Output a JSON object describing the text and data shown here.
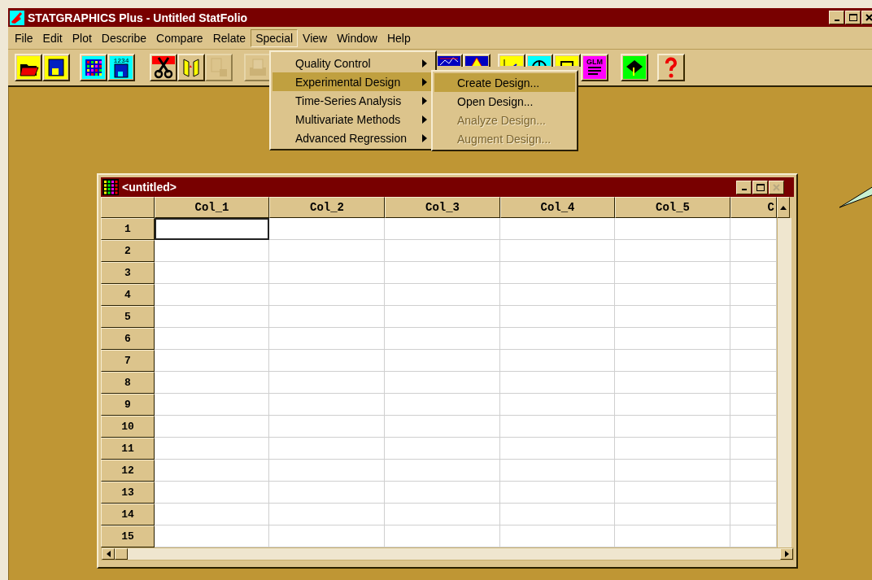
{
  "window": {
    "title": "STATGRAPHICS Plus - Untitled StatFolio",
    "controls": [
      {
        "kind": "minimize",
        "disabled": false
      },
      {
        "kind": "maximize",
        "disabled": false
      },
      {
        "kind": "close",
        "disabled": false
      }
    ]
  },
  "menu_bar": [
    {
      "label": "File",
      "selected": false
    },
    {
      "label": "Edit",
      "selected": false
    },
    {
      "label": "Plot",
      "selected": false
    },
    {
      "label": "Describe",
      "selected": false
    },
    {
      "label": "Compare",
      "selected": false
    },
    {
      "label": "Relate",
      "selected": false
    },
    {
      "label": "Special",
      "selected": true
    },
    {
      "label": "View",
      "selected": false
    },
    {
      "label": "Window",
      "selected": false
    },
    {
      "label": "Help",
      "selected": false
    }
  ],
  "toolbar": [
    [
      {
        "kind": "open",
        "disabled": false
      },
      {
        "kind": "save",
        "disabled": false
      }
    ],
    [
      {
        "kind": "grid",
        "disabled": false
      },
      {
        "kind": "numsave",
        "label": "1234",
        "disabled": false
      }
    ],
    [
      {
        "kind": "cut",
        "disabled": false
      },
      {
        "kind": "swap",
        "disabled": false
      },
      {
        "kind": "paste",
        "disabled": true
      }
    ],
    [
      {
        "kind": "print",
        "disabled": true
      }
    ],
    [
      {
        "kind": "chart",
        "disabled": false
      },
      {
        "kind": "letter",
        "disabled": false
      }
    ],
    [
      {
        "kind": "scatter",
        "disabled": false
      },
      {
        "kind": "globe",
        "disabled": false
      },
      {
        "kind": "box",
        "disabled": false
      },
      {
        "kind": "glm",
        "label": "GLM",
        "disabled": false
      }
    ],
    [
      {
        "kind": "hat",
        "disabled": false
      }
    ],
    [
      {
        "kind": "help",
        "disabled": false
      }
    ]
  ],
  "special_menu": [
    {
      "label": "Quality Control",
      "selected": false
    },
    {
      "label": "Experimental Design",
      "selected": true
    },
    {
      "label": "Time-Series Analysis",
      "selected": false
    },
    {
      "label": "Multivariate Methods",
      "selected": false
    },
    {
      "label": "Advanced Regression",
      "selected": false
    }
  ],
  "submenu": [
    {
      "label": "Create Design...",
      "selected": true,
      "disabled": false
    },
    {
      "label": "Open Design...",
      "selected": false,
      "disabled": false
    },
    {
      "label": "Analyze Design...",
      "selected": false,
      "disabled": true
    },
    {
      "label": "Augment Design...",
      "selected": false,
      "disabled": true
    }
  ],
  "datasheet": {
    "title": "<untitled>",
    "controls": [
      {
        "kind": "minimize",
        "disabled": false
      },
      {
        "kind": "maximize",
        "disabled": false
      },
      {
        "kind": "close",
        "disabled": true
      }
    ],
    "columns": [
      "Col_1",
      "Col_2",
      "Col_3",
      "Col_4",
      "Col_5",
      "C"
    ],
    "rows": [
      "1",
      "2",
      "3",
      "4",
      "5",
      "6",
      "7",
      "8",
      "9",
      "10",
      "11",
      "12",
      "13",
      "14",
      "15"
    ]
  }
}
